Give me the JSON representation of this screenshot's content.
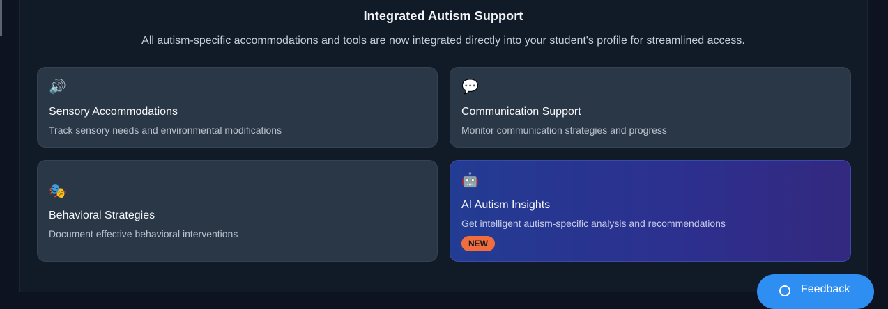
{
  "header": {
    "title": "Integrated Autism Support",
    "subtitle": "All autism-specific accommodations and tools are now integrated directly into your student's profile for streamlined access."
  },
  "cards": [
    {
      "icon": "🔊",
      "icon_name": "speaker-icon",
      "title": "Sensory Accommodations",
      "description": "Track sensory needs and environmental modifications"
    },
    {
      "icon": "💬",
      "icon_name": "speech-bubble-icon",
      "title": "Communication Support",
      "description": "Monitor communication strategies and progress"
    },
    {
      "icon": "🎭",
      "icon_name": "theater-masks-icon",
      "title": "Behavioral Strategies",
      "description": "Document effective behavioral interventions"
    },
    {
      "icon": "🤖",
      "icon_name": "robot-icon",
      "title": "AI Autism Insights",
      "description": "Get intelligent autism-specific analysis and recommendations",
      "badge": "NEW"
    }
  ],
  "feedback_button": {
    "label": "Feedback",
    "icon_name": "chat-icon"
  },
  "colors": {
    "background": "#0d1320",
    "panel": "#111a27",
    "card": "#2a3746",
    "ai_gradient_start": "#233c93",
    "ai_gradient_end": "#33297f",
    "badge": "#f26d3d",
    "feedback_button": "#2f8ef2"
  }
}
